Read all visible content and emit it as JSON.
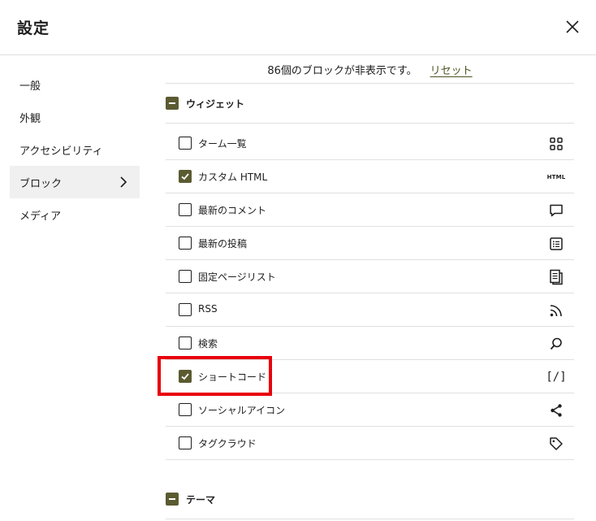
{
  "header": {
    "title": "設定",
    "close_icon": "close-icon"
  },
  "sidebar": {
    "items": [
      {
        "label": "一般",
        "active": false
      },
      {
        "label": "外観",
        "active": false
      },
      {
        "label": "アクセシビリティ",
        "active": false
      },
      {
        "label": "ブロック",
        "active": true
      },
      {
        "label": "メディア",
        "active": false
      }
    ]
  },
  "main": {
    "hidden_count_text": "86個のブロックが非表示です。",
    "reset_label": "リセット",
    "categories": [
      {
        "label": "ウィジェット"
      },
      {
        "label": "テーマ"
      }
    ],
    "blocks": [
      {
        "label": "ターム一覧",
        "checked": false,
        "icon": "grid-icon"
      },
      {
        "label": "カスタム HTML",
        "checked": true,
        "icon": "html-icon",
        "icon_text": "HTML"
      },
      {
        "label": "最新のコメント",
        "checked": false,
        "icon": "comment-icon"
      },
      {
        "label": "最新の投稿",
        "checked": false,
        "icon": "post-list-icon"
      },
      {
        "label": "固定ページリスト",
        "checked": false,
        "icon": "page-list-icon"
      },
      {
        "label": "RSS",
        "checked": false,
        "icon": "rss-icon"
      },
      {
        "label": "検索",
        "checked": false,
        "icon": "search-icon"
      },
      {
        "label": "ショートコード",
        "checked": true,
        "icon": "shortcode-icon",
        "icon_text": "[/]"
      },
      {
        "label": "ソーシャルアイコン",
        "checked": false,
        "icon": "share-icon"
      },
      {
        "label": "タグクラウド",
        "checked": false,
        "icon": "tag-icon"
      }
    ]
  },
  "colors": {
    "accent": "#5b5b32",
    "link": "#4b5320",
    "highlight": "#e8000b"
  }
}
